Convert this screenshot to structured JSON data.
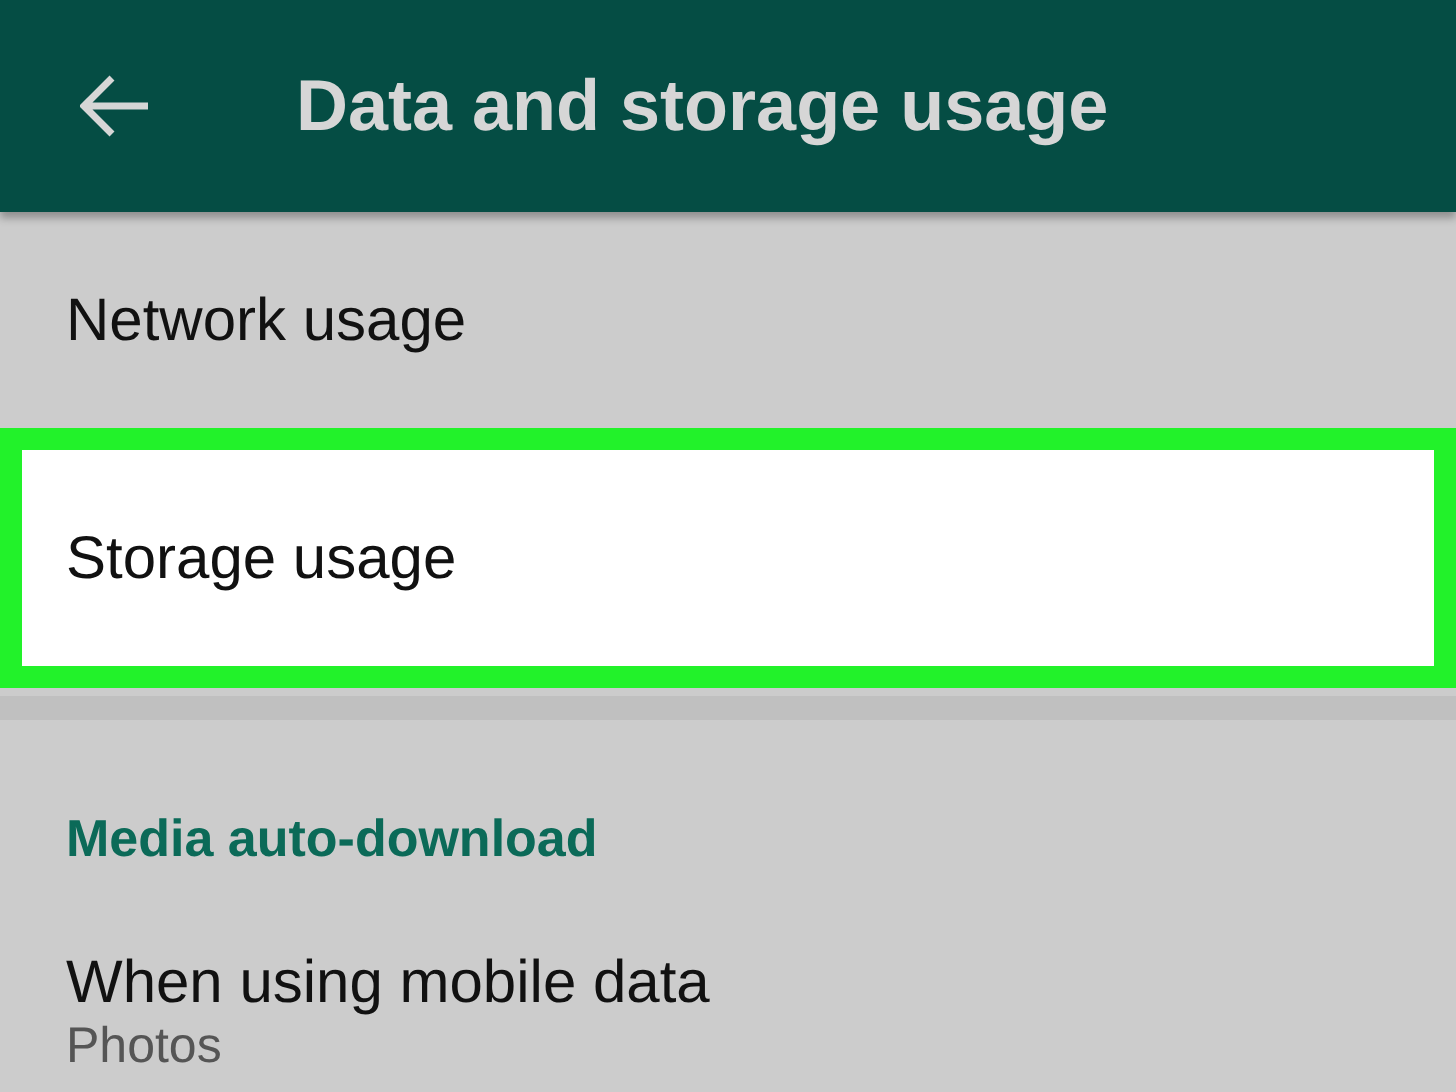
{
  "app_bar": {
    "title": "Data and storage usage"
  },
  "items": [
    {
      "label": "Network usage",
      "highlighted": false
    },
    {
      "label": "Storage usage",
      "highlighted": true
    }
  ],
  "section": {
    "title": "Media auto-download",
    "items": [
      {
        "label": "When using mobile data",
        "summary": "Photos"
      }
    ]
  }
}
